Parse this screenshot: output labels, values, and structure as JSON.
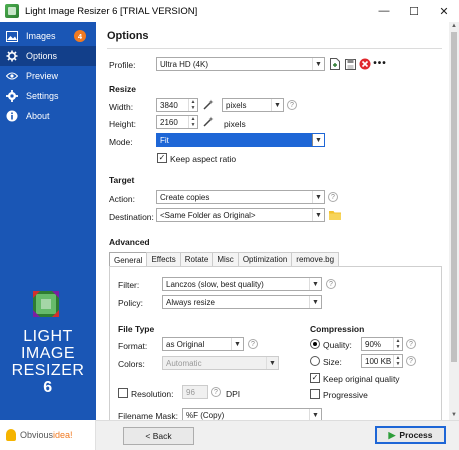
{
  "window": {
    "title": "Light Image Resizer 6  [TRIAL VERSION]",
    "minimize": "—",
    "maximize": "☐",
    "close": "✕"
  },
  "sidebar": {
    "items": [
      {
        "label": "Images",
        "icon": "images-icon",
        "badge": "4"
      },
      {
        "label": "Options",
        "icon": "gear-icon"
      },
      {
        "label": "Preview",
        "icon": "eye-icon"
      },
      {
        "label": "Settings",
        "icon": "settings-icon"
      },
      {
        "label": "About",
        "icon": "info-icon"
      }
    ],
    "logo_lines": [
      "LIGHT",
      "IMAGE",
      "RESIZER",
      "6"
    ],
    "vendor_prefix": "Obvious",
    "vendor_suffix": "idea!"
  },
  "options": {
    "title": "Options",
    "profile_label": "Profile:",
    "profile_value": "Ultra HD (4K)",
    "resize_section": "Resize",
    "width_label": "Width:",
    "width_value": "3840",
    "height_label": "Height:",
    "height_value": "2160",
    "unit_value": "pixels",
    "unit_text": "pixels",
    "mode_label": "Mode:",
    "mode_value": "Fit",
    "keep_aspect_label": "Keep aspect ratio",
    "target_section": "Target",
    "action_label": "Action:",
    "action_value": "Create copies",
    "destination_label": "Destination:",
    "destination_value": "<Same Folder as Original>",
    "advanced_section": "Advanced"
  },
  "tabs": [
    "General",
    "Effects",
    "Rotate",
    "Misc",
    "Optimization",
    "remove.bg"
  ],
  "general": {
    "filter_label": "Filter:",
    "filter_value": "Lanczos  (slow, best quality)",
    "policy_label": "Policy:",
    "policy_value": "Always resize",
    "filetype_section": "File Type",
    "format_label": "Format:",
    "format_value": "as Original",
    "colors_label": "Colors:",
    "colors_value": "Automatic",
    "resolution_label": "Resolution:",
    "resolution_value": "96",
    "dpi_label": "DPI",
    "filename_label": "Filename Mask:",
    "filename_value": "%F (Copy)",
    "compression_section": "Compression",
    "quality_label": "Quality:",
    "quality_value": "90%",
    "size_label": "Size:",
    "size_value": "100 KB",
    "keep_quality_label": "Keep original quality",
    "progressive_label": "Progressive"
  },
  "footer": {
    "back_label": "< Back",
    "process_label": "Process"
  },
  "colors": {
    "sidebar": "#1a56b5",
    "sidebar_active": "#123f8a",
    "accent": "#1e66d6",
    "badge": "#f07a22"
  }
}
